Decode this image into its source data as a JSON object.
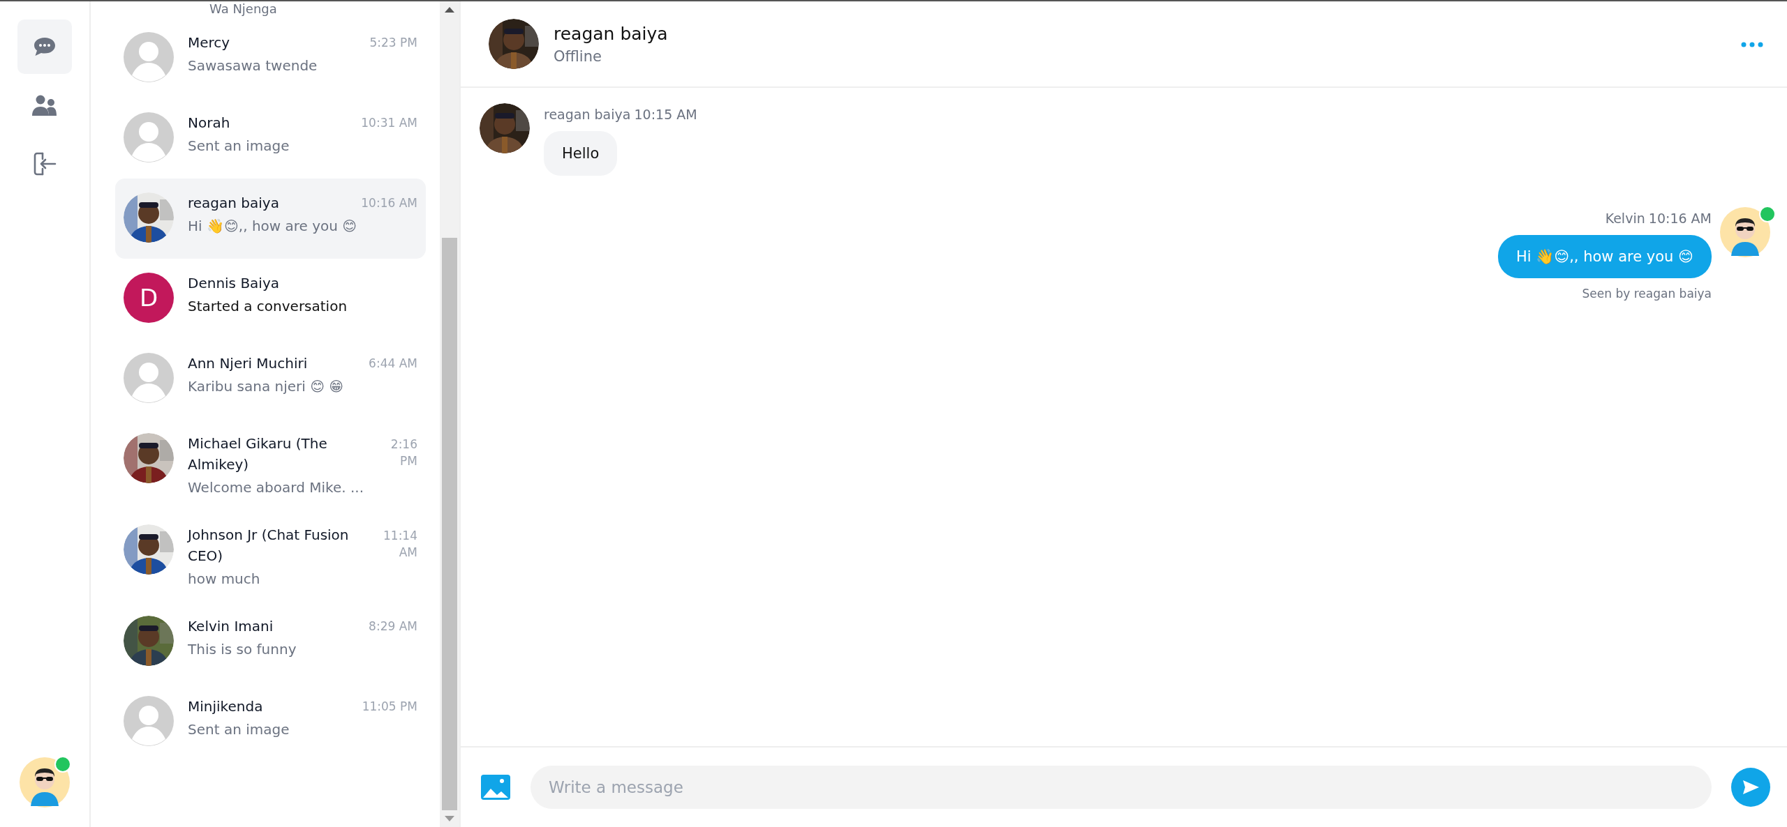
{
  "nav": {
    "items": [
      {
        "kind": "chat",
        "selected": true
      },
      {
        "kind": "contacts",
        "selected": false
      },
      {
        "kind": "logout",
        "selected": false
      }
    ],
    "user": {
      "online": true
    }
  },
  "conversations": {
    "clipped_top": {
      "preview": "Wa Njenga"
    },
    "items": [
      {
        "name": "Mercy",
        "time": "5:23 PM",
        "preview": "Sawasawa twende",
        "kind": "default",
        "selected": false,
        "unread": false
      },
      {
        "name": "Norah",
        "time": "10:31 AM",
        "preview": "Sent an image",
        "kind": "default",
        "selected": false,
        "unread": false
      },
      {
        "name": "reagan baiya",
        "time": "10:16 AM",
        "preview": "Hi 👋😊,, how are you 😊",
        "selected": true,
        "unread": false
      },
      {
        "name": "Dennis Baiya",
        "preview": "Started a conversation",
        "kind": "initial",
        "initial": "D",
        "color": "#c2185b",
        "selected": false,
        "unread": true
      },
      {
        "name": "Ann Njeri Muchiri",
        "time": "6:44 AM",
        "preview": "Karibu sana njeri 😊 😁",
        "kind": "default",
        "selected": false,
        "unread": false
      },
      {
        "name": "Michael Gikaru (The Almikey)",
        "time": "2:16 PM",
        "preview": "Welcome aboard Mike. ...",
        "selected": false,
        "unread": false
      },
      {
        "name": "Johnson Jr (Chat Fusion CEO)",
        "time": "11:14 AM",
        "preview": "how much",
        "selected": false,
        "unread": false
      },
      {
        "name": "Kelvin Imani",
        "time": "8:29 AM",
        "preview": "This is so funny",
        "selected": false,
        "unread": false
      },
      {
        "name": "Minjikenda",
        "time": "11:05 PM",
        "preview": "Sent an image",
        "kind": "default",
        "selected": false,
        "unread": false
      }
    ]
  },
  "chat": {
    "header": {
      "name": "reagan baiya",
      "status": "Offline"
    },
    "messages": [
      {
        "kind": "incoming",
        "sender": "reagan baiya",
        "time": "10:15 AM",
        "text": "Hello"
      },
      {
        "kind": "outgoing",
        "sender": "Kelvin",
        "time": "10:16 AM",
        "text": "Hi 👋😊,, how are you 😊",
        "seen": "Seen by reagan baiya",
        "online": true
      }
    ],
    "composer": {
      "placeholder": "Write a message"
    }
  }
}
